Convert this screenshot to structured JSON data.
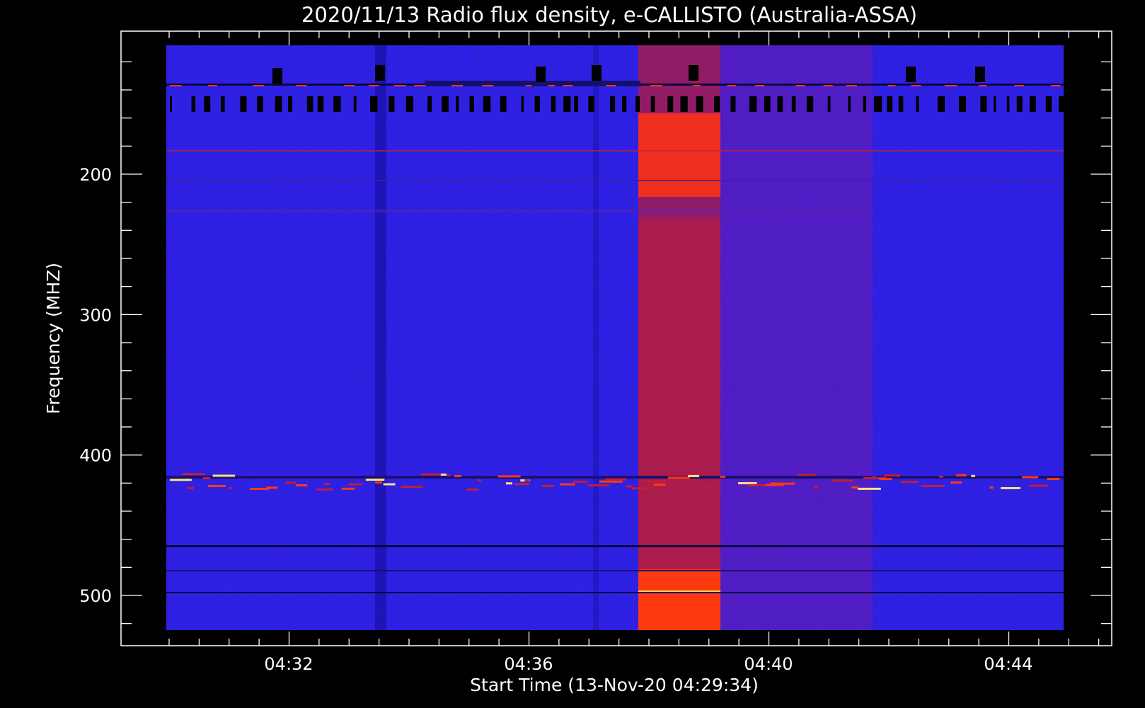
{
  "chart_data": {
    "type": "heatmap",
    "title": "2020/11/13  Radio flux density, e-CALLISTO (Australia-ASSA)",
    "xlabel": "Start Time (13-Nov-20 04:29:34)",
    "ylabel": "Frequency (MHZ)",
    "x_ticks": [
      "04:32",
      "04:36",
      "04:40",
      "04:44"
    ],
    "y_ticks": [
      200,
      300,
      400,
      500
    ],
    "colors": {
      "background": "#000000",
      "axes": "#ffffff",
      "low": "#2b1ff0",
      "high": "#ff3a10",
      "burst": "#ffd060"
    }
  }
}
